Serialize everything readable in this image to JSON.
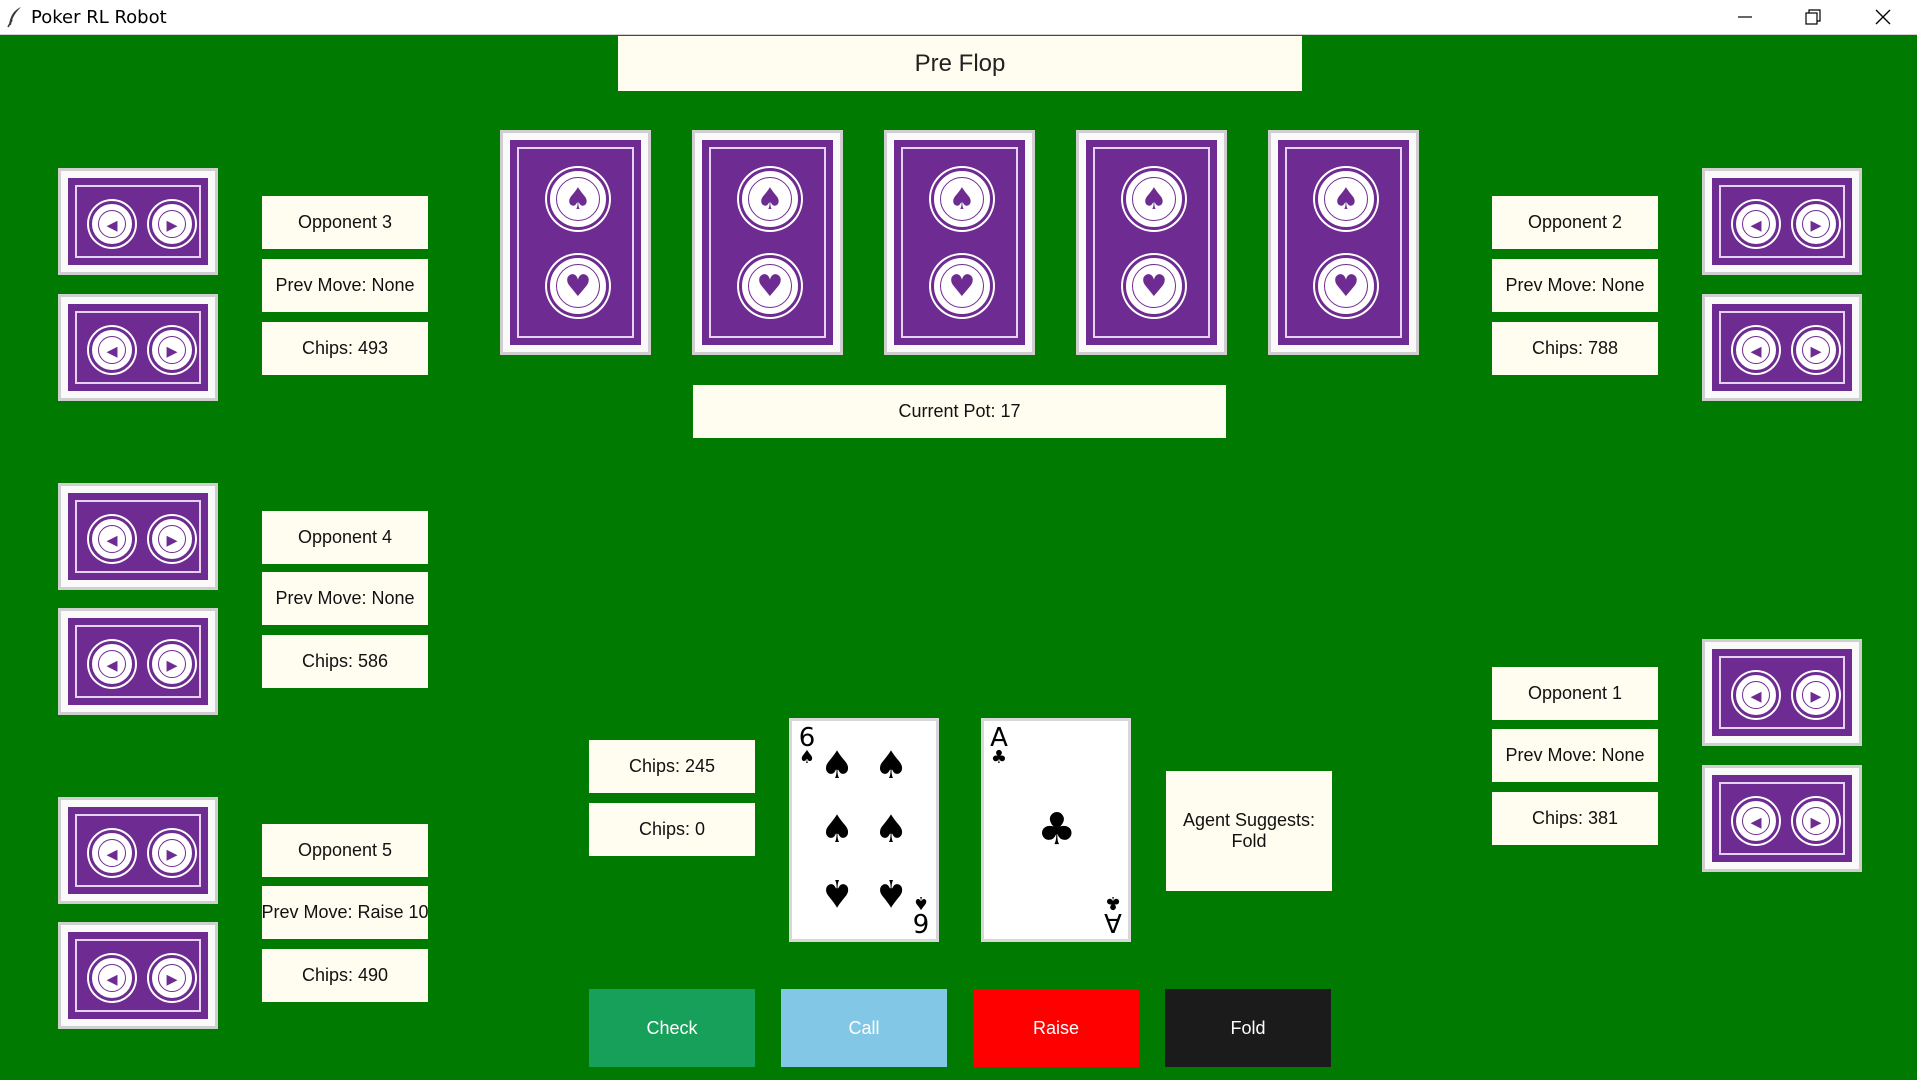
{
  "window": {
    "title": "Poker RL Robot"
  },
  "table": {
    "stage": "Pre Flop",
    "pot_label": "Current Pot: 17",
    "community_cards": [
      {
        "state": "face-down"
      },
      {
        "state": "face-down"
      },
      {
        "state": "face-down"
      },
      {
        "state": "face-down"
      },
      {
        "state": "face-down"
      }
    ]
  },
  "opponents": {
    "opponent1": {
      "name": "Opponent 1",
      "prev_move": "Prev Move: None",
      "chips": "Chips: 381"
    },
    "opponent2": {
      "name": "Opponent 2",
      "prev_move": "Prev Move: None",
      "chips": "Chips: 788"
    },
    "opponent3": {
      "name": "Opponent 3",
      "prev_move": "Prev Move: None",
      "chips": "Chips: 493"
    },
    "opponent4": {
      "name": "Opponent 4",
      "prev_move": "Prev Move: None",
      "chips": "Chips: 586"
    },
    "opponent5": {
      "name": "Opponent 5",
      "prev_move": "Prev Move: Raise 10",
      "chips": "Chips: 490"
    }
  },
  "player": {
    "chips": "Chips: 245",
    "bet": "Chips: 0",
    "hand": [
      {
        "rank": "6",
        "suit": "♠",
        "suit_name": "spades"
      },
      {
        "rank": "A",
        "suit": "♣",
        "suit_name": "clubs"
      }
    ],
    "agent_suggestion_line1": "Agent Suggests:",
    "agent_suggestion_line2": "Fold"
  },
  "actions": {
    "check": "Check",
    "call": "Call",
    "raise": "Raise",
    "fold": "Fold"
  },
  "colors": {
    "table_felt": "#007a00",
    "card_back": "#6e2c92",
    "label_bg": "#fffdf0",
    "check": "#17a05a",
    "call": "#82c8e6",
    "raise": "#ff0000",
    "fold": "#1b1b1b"
  },
  "icons": {
    "app": "feather-icon",
    "minimize": "minimize-icon",
    "maximize": "restore-icon",
    "close": "close-icon",
    "card_back_emblem": "card-emblem-icon"
  }
}
